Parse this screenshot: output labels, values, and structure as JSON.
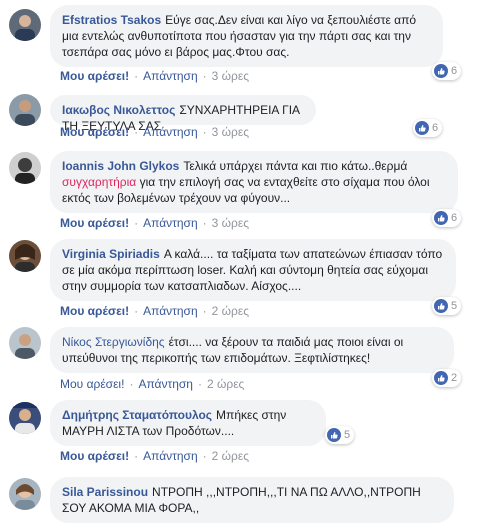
{
  "actions": {
    "like": "Μου αρέσει!",
    "reply": "Απάντηση",
    "sep": "·"
  },
  "colors": {
    "link": "#385898",
    "bubble": "#f2f3f5",
    "like_blue": "#4267b2",
    "meta": "#90949c"
  },
  "comments": [
    {
      "author": "Efstratios Tsakos",
      "text": "Εύγε σας.Δεν είναι και λίγο να ξεπουλιέστε από μια εντελώς ανθυποτίποτα που ήσασταν για την πάρτι σας και την τσεπάρα σας μόνο ει βάρος μας.Φτου σας.",
      "time": "3 ώρες",
      "reactions": "6"
    },
    {
      "author": "Ιακωβος Νικολεττος",
      "text": "ΣΥΝΧΑΡΗΤΗΡΕΙΑ ΓΙΑ ΤΗ ΞΕΥΤΥΛΑ ΣΑΣ",
      "time": "3 ώρες",
      "reactions": "6"
    },
    {
      "author": "Ioannis John Glykos",
      "text_before": "Τελικά υπάρχει πάντα και πιο κάτω..θερμά",
      "mention": "συγχαρητήρια",
      "text_after": "για την επιλογή σας να ενταχθείτε στο σίχαμα που όλοι εκτός των βολεμένων τρέχουν να φύγουν...",
      "time": "3 ώρες",
      "reactions": "6"
    },
    {
      "author": "Virginia Spiriadis",
      "text": "Α καλά.... τα ταξίματα των απατεώνων έπιασαν τόπο σε μία ακόμα περίπτωση loser. Καλή και σύντομη θητεία σας εύχομαι στην συμμορία των κατσαπλιαδων. Αίσχος....",
      "time": "2 ώρες",
      "reactions": "5"
    },
    {
      "author": "Νίκος Στεργιωνίδης",
      "text": "έτσι.... να ξέρουν τα παιδιά μας ποιοι είναι οι υπεύθυνοι της περικοπής των επιδομάτων. Ξεφτιλίστηκες!",
      "time": "2 ώρες",
      "reactions": "2"
    },
    {
      "author": "Δημήτρης Σταματόπουλος",
      "text": "Μπήκες στην ΜΑΥΡΗ ΛΙΣΤΑ των Προδότων....",
      "time": "2 ώρες",
      "reactions": "5"
    },
    {
      "author": "Sila Parissinou",
      "text": "ΝΤΡΟΠΗ ,,,ΝΤΡΟΠΗ,,,ΤΙ ΝΑ ΠΩ ΑΛΛΟ,,ΝΤΡΟΠΗ ΣΟΥ ΑΚΟΜΑ ΜΙΑ ΦΟΡΑ,,",
      "time": "",
      "reactions": ""
    }
  ]
}
